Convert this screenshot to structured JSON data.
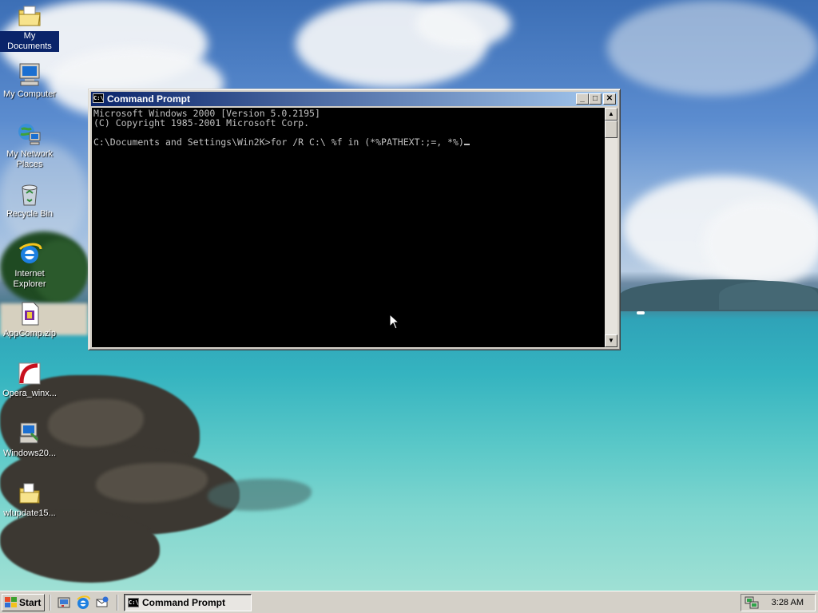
{
  "desktop": {
    "icons": [
      {
        "label": "My Documents",
        "icon": "my-documents-folder-icon"
      },
      {
        "label": "My Computer",
        "icon": "my-computer-icon"
      },
      {
        "label": "My Network Places",
        "icon": "network-places-icon"
      },
      {
        "label": "Recycle Bin",
        "icon": "recycle-bin-icon"
      },
      {
        "label": "Internet Explorer",
        "icon": "internet-explorer-icon"
      },
      {
        "label": "AppComp.zip",
        "icon": "zip-file-icon"
      },
      {
        "label": "Opera_winx...",
        "icon": "opera-installer-icon"
      },
      {
        "label": "Windows20...",
        "icon": "windows-setup-icon"
      },
      {
        "label": "wlupdate15...",
        "icon": "folder-file-icon"
      }
    ]
  },
  "window": {
    "title": "Command Prompt",
    "buttons": {
      "minimize": "_",
      "maximize": "□",
      "close": "✕"
    },
    "console": {
      "line1": "Microsoft Windows 2000 [Version 5.0.2195]",
      "line2": "(C) Copyright 1985-2001 Microsoft Corp.",
      "prompt": "C:\\Documents and Settings\\Win2K>",
      "command": "for /R C:\\ %f in (*%PATHEXT:;=, *%)"
    }
  },
  "taskbar": {
    "start_label": "Start",
    "quick_launch": [
      "show-desktop-icon",
      "internet-explorer-icon",
      "outlook-express-icon"
    ],
    "tasks": [
      {
        "label": "Command Prompt",
        "icon": "command-prompt-icon"
      }
    ],
    "tray": {
      "icons": [
        "network-icon"
      ],
      "clock": "3:28 AM"
    }
  },
  "colors": {
    "titlebar_start": "#0a246a",
    "titlebar_end": "#a6caf0",
    "console_bg": "#000000",
    "console_fg": "#c0c0c0",
    "chrome": "#d4d0c8",
    "selection": "#0a246a"
  }
}
